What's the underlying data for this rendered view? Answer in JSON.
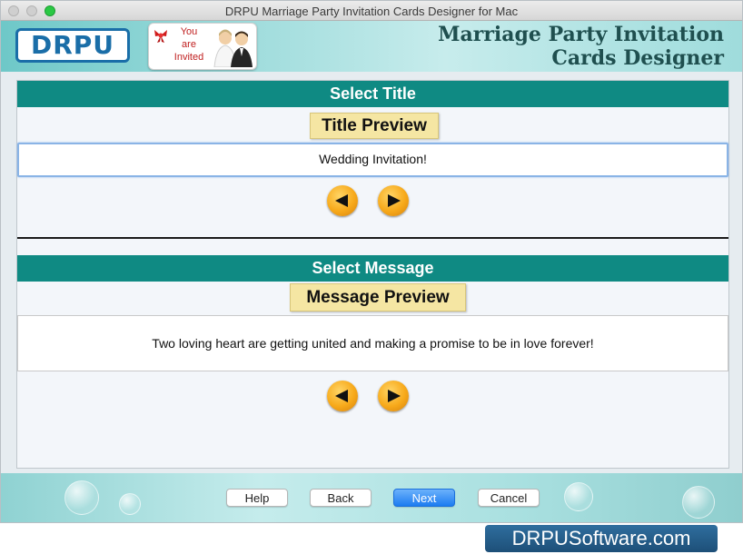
{
  "window": {
    "title": "DRPU Marriage Party Invitation Cards Designer for Mac"
  },
  "banner": {
    "logo": "DRPU",
    "invite_text": [
      "You",
      "are",
      "Invited"
    ],
    "brand_title_line1": "Marriage Party Invitation",
    "brand_title_line2": "Cards Designer"
  },
  "title_section": {
    "header": "Select Title",
    "preview_label": "Title Preview",
    "value": "Wedding Invitation!"
  },
  "message_section": {
    "header": "Select Message",
    "preview_label": "Message Preview",
    "value": "Two loving heart are getting united and making a promise to be in love forever!"
  },
  "buttons": {
    "help": "Help",
    "back": "Back",
    "next": "Next",
    "cancel": "Cancel"
  },
  "watermark": "DRPUSoftware.com",
  "colors": {
    "teal_header": "#0f8a83",
    "preview_label": "#f5e6a3",
    "arrow": "#f7a91a",
    "primary_button": "#1c7cf1"
  }
}
